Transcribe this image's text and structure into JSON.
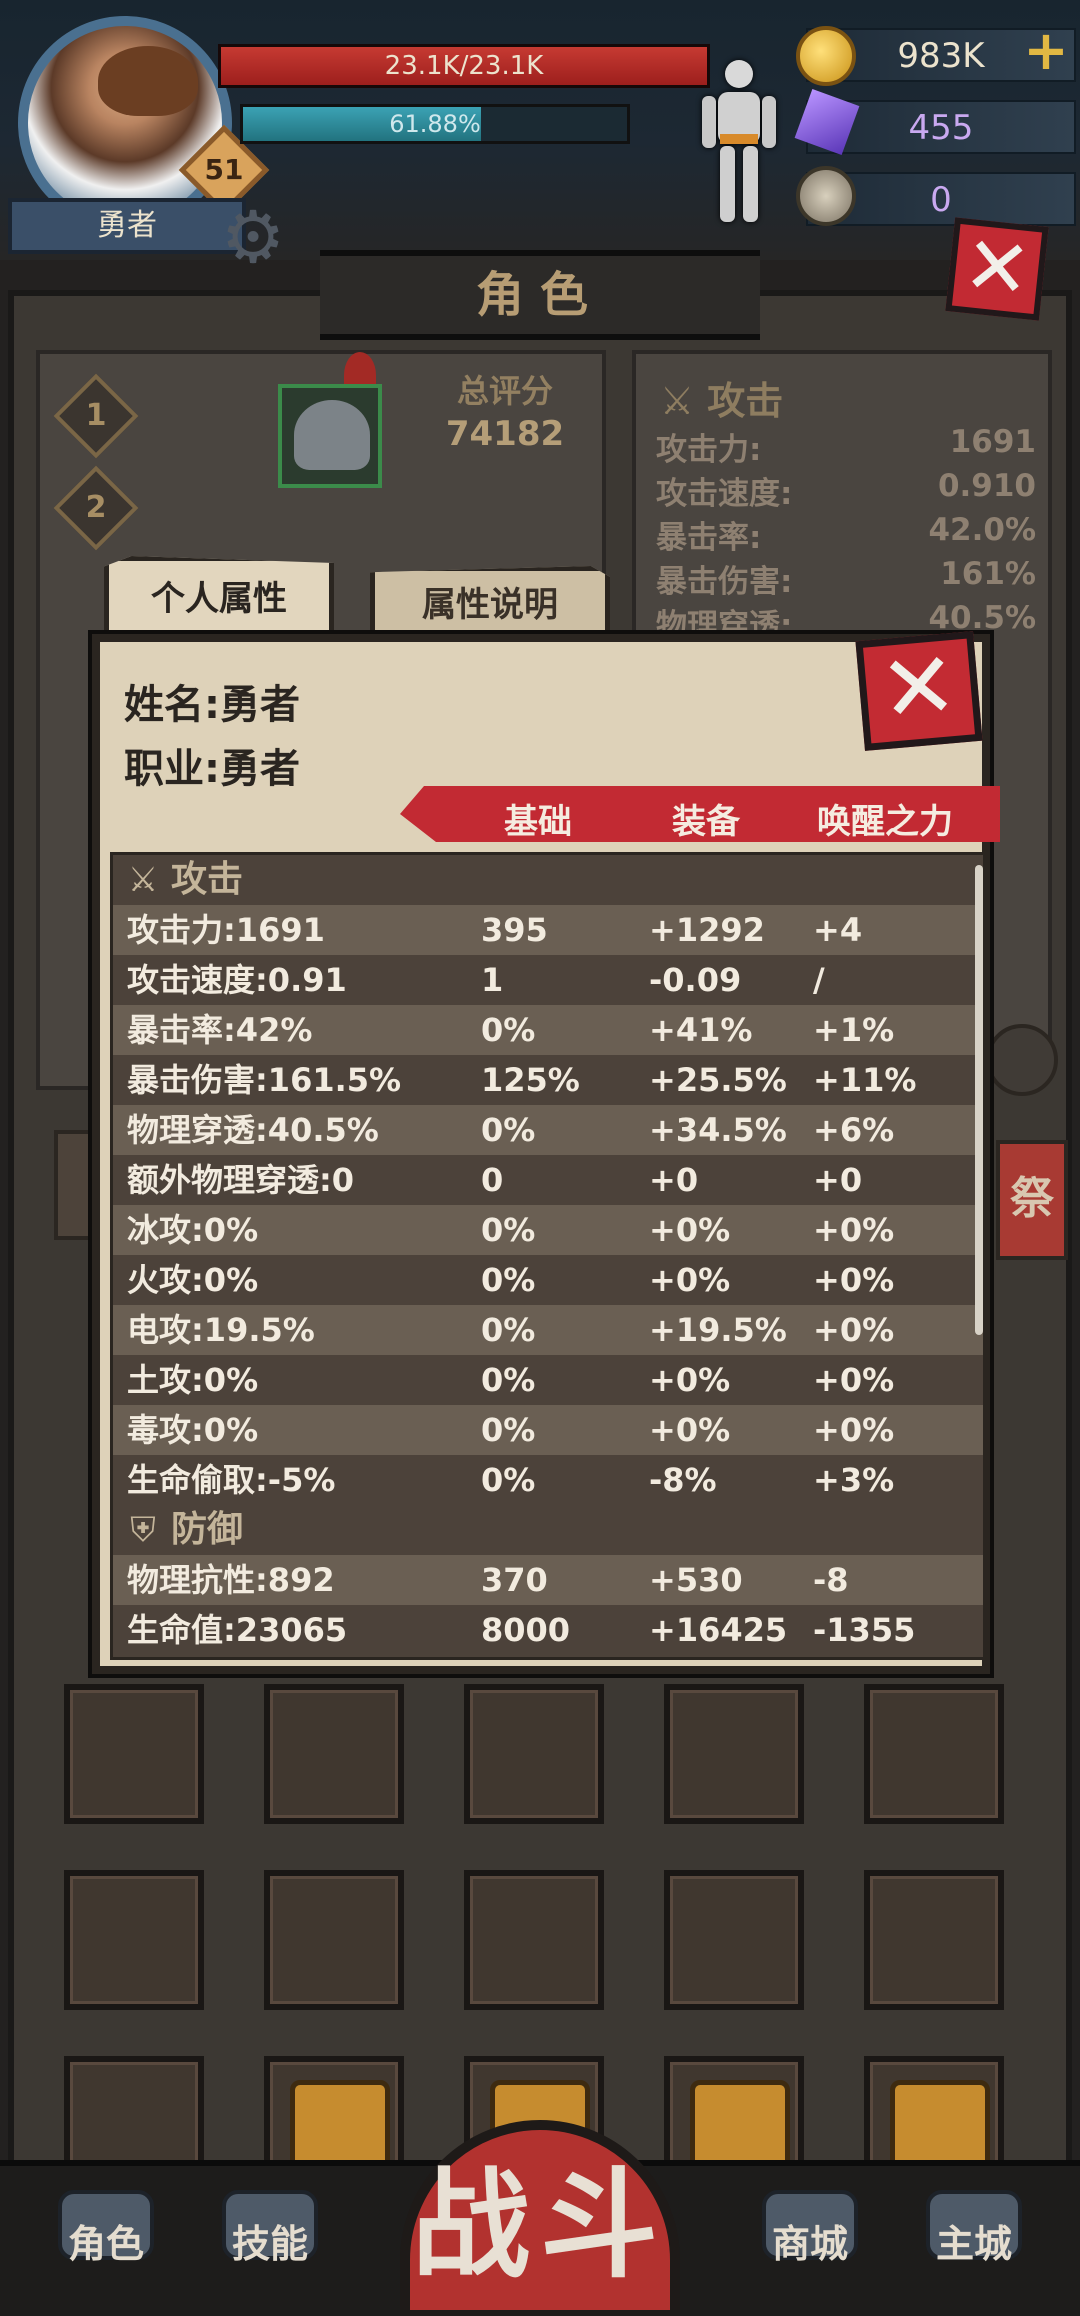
{
  "hero": {
    "name": "勇者",
    "level": "51"
  },
  "bars": {
    "hp_text": "23.1K/23.1K",
    "hp_fraction": 1.0,
    "xp_text": "61.88%",
    "xp_fraction": 0.6188
  },
  "resources": {
    "gold": "983K",
    "gems": "455",
    "horns": "0",
    "add_label": "+"
  },
  "page_title": "角色",
  "left_panel": {
    "slot1": "1",
    "slot2": "2",
    "score_label": "总评分",
    "score_value": "74182"
  },
  "right_panel": {
    "section": "攻击",
    "rows": [
      {
        "k": "攻击力:",
        "v": "1691"
      },
      {
        "k": "攻击速度:",
        "v": "0.910"
      },
      {
        "k": "暴击率:",
        "v": "42.0%"
      },
      {
        "k": "暴击伤害:",
        "v": "161%"
      },
      {
        "k": "物理穿透:",
        "v": "40.5%"
      }
    ]
  },
  "tabs": {
    "personal": "个人属性",
    "explain": "属性说明"
  },
  "modal": {
    "name_line": "姓名:勇者",
    "class_line": "职业:勇者",
    "headers": {
      "base": "基础",
      "equip": "装备",
      "awaken": "唤醒之力"
    },
    "sections": {
      "attack": "攻击",
      "defense": "防御"
    },
    "attack_rows": [
      {
        "stat": "攻击力:1691",
        "base": "395",
        "equip": "+1292",
        "awaken": "+4"
      },
      {
        "stat": "攻击速度:0.91",
        "base": "1",
        "equip": "-0.09",
        "awaken": "/"
      },
      {
        "stat": "暴击率:42%",
        "base": "0%",
        "equip": "+41%",
        "awaken": "+1%"
      },
      {
        "stat": "暴击伤害:161.5%",
        "base": "125%",
        "equip": "+25.5%",
        "awaken": "+11%"
      },
      {
        "stat": "物理穿透:40.5%",
        "base": "0%",
        "equip": "+34.5%",
        "awaken": "+6%"
      },
      {
        "stat": "额外物理穿透:0",
        "base": "0",
        "equip": "+0",
        "awaken": "+0"
      },
      {
        "stat": "冰攻:0%",
        "base": "0%",
        "equip": "+0%",
        "awaken": "+0%"
      },
      {
        "stat": "火攻:0%",
        "base": "0%",
        "equip": "+0%",
        "awaken": "+0%"
      },
      {
        "stat": "电攻:19.5%",
        "base": "0%",
        "equip": "+19.5%",
        "awaken": "+0%"
      },
      {
        "stat": "土攻:0%",
        "base": "0%",
        "equip": "+0%",
        "awaken": "+0%"
      },
      {
        "stat": "毒攻:0%",
        "base": "0%",
        "equip": "+0%",
        "awaken": "+0%"
      },
      {
        "stat": "生命偷取:-5%",
        "base": "0%",
        "equip": "-8%",
        "awaken": "+3%"
      }
    ],
    "defense_rows": [
      {
        "stat": "物理抗性:892",
        "base": "370",
        "equip": "+530",
        "awaken": "-8"
      },
      {
        "stat": "生命值:23065",
        "base": "8000",
        "equip": "+16425",
        "awaken": "-1355"
      }
    ]
  },
  "side": {
    "right_btn": "祭"
  },
  "nav": {
    "role": "角色",
    "skill": "技能",
    "fight": "战斗",
    "shop": "商城",
    "city": "主城"
  },
  "icons": {
    "coin": "coin-icon",
    "gem": "gem-icon",
    "horn": "horn-icon",
    "gear": "gear-icon",
    "sword": "crossed-swords-icon",
    "shield": "shield-icon",
    "close": "close-icon",
    "search": "magnifier-icon",
    "lock": "lock-icon"
  },
  "colors": {
    "hp": "#c63a32",
    "xp": "#3ba2b4",
    "accent_red": "#c22a33",
    "parchment": "#ded2b9"
  }
}
